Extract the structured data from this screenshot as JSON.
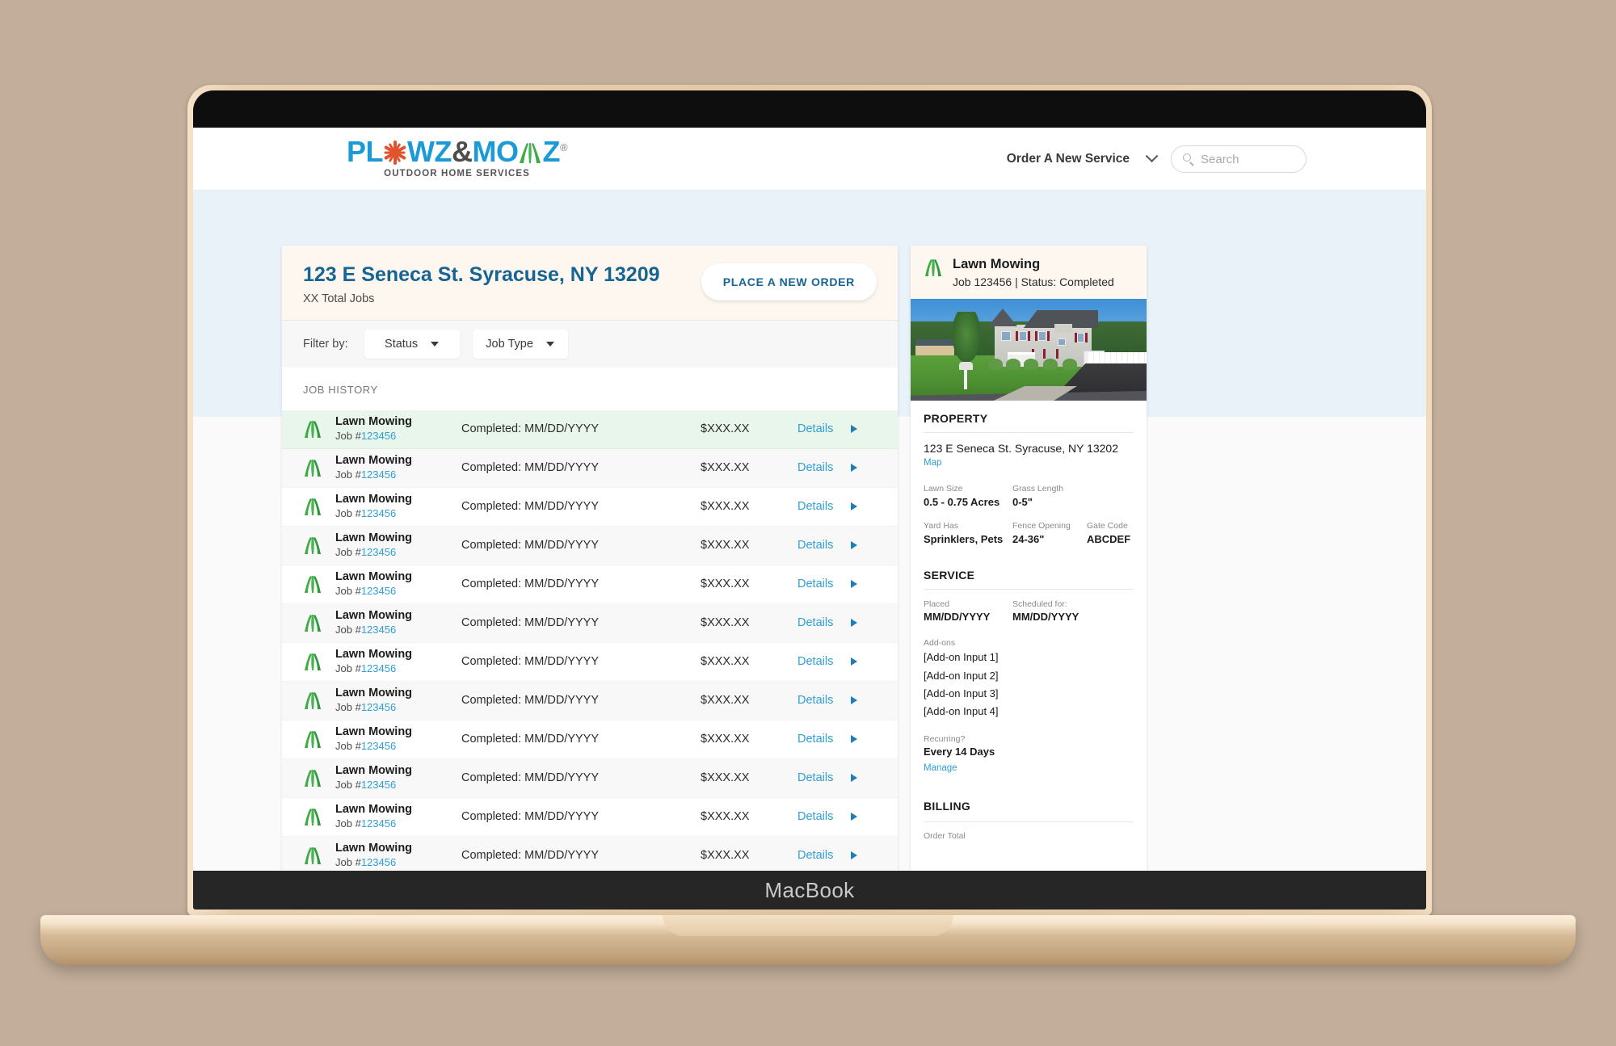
{
  "device": {
    "wordmark": "MacBook"
  },
  "header": {
    "logo": {
      "part1": "PL",
      "snowflake": "snowflake-icon",
      "part2": "WZ",
      "amp": "&",
      "part3": "MO",
      "part4": "Z",
      "registered": "®",
      "tagline": "OUTDOOR HOME SERVICES"
    },
    "order_service_label": "Order A New Service",
    "search_placeholder": "Search"
  },
  "jobs_card": {
    "property_title": "123 E Seneca St. Syracuse, NY 13209",
    "total_jobs": "XX Total Jobs",
    "place_order_label": "PLACE A NEW ORDER",
    "filter_label": "Filter by:",
    "filters": [
      {
        "label": "Status"
      },
      {
        "label": "Job Type"
      }
    ],
    "job_history_label": "JOB HISTORY",
    "rows": [
      {
        "service": "Lawn Mowing",
        "job_prefix": "Job #",
        "job_number": "123456",
        "status": "Completed: MM/DD/YYYY",
        "price": "$XXX.XX",
        "details": "Details"
      },
      {
        "service": "Lawn Mowing",
        "job_prefix": "Job #",
        "job_number": "123456",
        "status": "Completed: MM/DD/YYYY",
        "price": "$XXX.XX",
        "details": "Details"
      },
      {
        "service": "Lawn Mowing",
        "job_prefix": "Job #",
        "job_number": "123456",
        "status": "Completed: MM/DD/YYYY",
        "price": "$XXX.XX",
        "details": "Details"
      },
      {
        "service": "Lawn Mowing",
        "job_prefix": "Job #",
        "job_number": "123456",
        "status": "Completed: MM/DD/YYYY",
        "price": "$XXX.XX",
        "details": "Details"
      },
      {
        "service": "Lawn Mowing",
        "job_prefix": "Job #",
        "job_number": "123456",
        "status": "Completed: MM/DD/YYYY",
        "price": "$XXX.XX",
        "details": "Details"
      },
      {
        "service": "Lawn Mowing",
        "job_prefix": "Job #",
        "job_number": "123456",
        "status": "Completed: MM/DD/YYYY",
        "price": "$XXX.XX",
        "details": "Details"
      },
      {
        "service": "Lawn Mowing",
        "job_prefix": "Job #",
        "job_number": "123456",
        "status": "Completed: MM/DD/YYYY",
        "price": "$XXX.XX",
        "details": "Details"
      },
      {
        "service": "Lawn Mowing",
        "job_prefix": "Job #",
        "job_number": "123456",
        "status": "Completed: MM/DD/YYYY",
        "price": "$XXX.XX",
        "details": "Details"
      },
      {
        "service": "Lawn Mowing",
        "job_prefix": "Job #",
        "job_number": "123456",
        "status": "Completed: MM/DD/YYYY",
        "price": "$XXX.XX",
        "details": "Details"
      },
      {
        "service": "Lawn Mowing",
        "job_prefix": "Job #",
        "job_number": "123456",
        "status": "Completed: MM/DD/YYYY",
        "price": "$XXX.XX",
        "details": "Details"
      },
      {
        "service": "Lawn Mowing",
        "job_prefix": "Job #",
        "job_number": "123456",
        "status": "Completed: MM/DD/YYYY",
        "price": "$XXX.XX",
        "details": "Details"
      },
      {
        "service": "Lawn Mowing",
        "job_prefix": "Job #",
        "job_number": "123456",
        "status": "Completed: MM/DD/YYYY",
        "price": "$XXX.XX",
        "details": "Details"
      }
    ]
  },
  "detail_panel": {
    "service_name": "Lawn Mowing",
    "job_status_line": "Job 123456 | Status: Completed",
    "property": {
      "heading": "PROPERTY",
      "address": "123 E Seneca St. Syracuse, NY 13202",
      "map_link": "Map",
      "lawn_size_label": "Lawn Size",
      "lawn_size_value": "0.5 - 0.75 Acres",
      "grass_length_label": "Grass Length",
      "grass_length_value": "0-5\"",
      "yard_has_label": "Yard Has",
      "yard_has_value": "Sprinklers, Pets",
      "fence_opening_label": "Fence Opening",
      "fence_opening_value": "24-36\"",
      "gate_code_label": "Gate Code",
      "gate_code_value": "ABCDEF"
    },
    "service": {
      "heading": "SERVICE",
      "placed_label": "Placed",
      "placed_value": "MM/DD/YYYY",
      "scheduled_label": "Scheduled for:",
      "scheduled_value": "MM/DD/YYYY",
      "addons_label": "Add-ons",
      "addons": [
        "[Add-on Input 1]",
        "[Add-on Input 2]",
        "[Add-on Input 3]",
        "[Add-on Input 4]"
      ],
      "recurring_label": "Recurring?",
      "recurring_value": "Every 14 Days",
      "manage_link": "Manage"
    },
    "billing": {
      "heading": "BILLING",
      "order_total_label": "Order Total"
    }
  },
  "colors": {
    "brand_blue": "#1b9ad6",
    "title_blue": "#166493",
    "link_blue": "#2f9fd4",
    "grass_green": "#3faa46",
    "snowflake_orange": "#e0532c",
    "selected_row": "#e9f6ec",
    "page_band": "#e9f1f9",
    "card_header_cream": "#fdf7f0",
    "backdrop": "#c3ae9b"
  }
}
